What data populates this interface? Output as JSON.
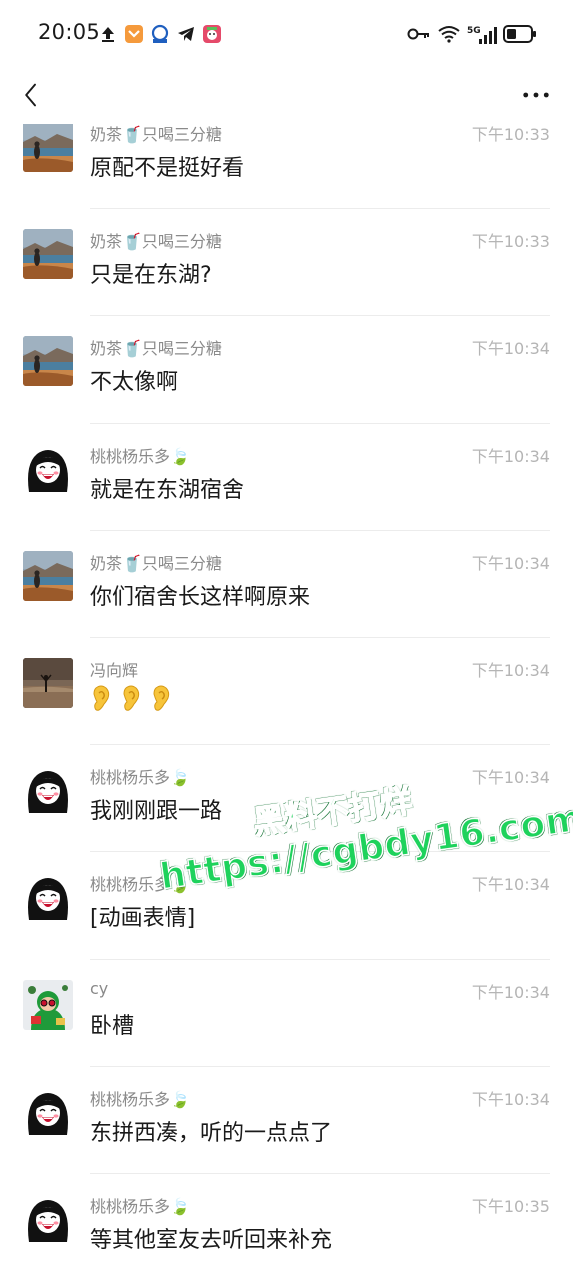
{
  "status_bar": {
    "time": "20:05",
    "network_label": "5G"
  },
  "watermark": {
    "line1": "黑料不打烊",
    "line2": "https://cgbdy16.com"
  },
  "messages": [
    {
      "sender": "奶茶🥤只喝三分糖",
      "time": "下午10:33",
      "text": "原配不是挺好看",
      "avatar": "landscape"
    },
    {
      "sender": "奶茶🥤只喝三分糖",
      "time": "下午10:33",
      "text": "只是在东湖?",
      "avatar": "landscape"
    },
    {
      "sender": "奶茶🥤只喝三分糖",
      "time": "下午10:34",
      "text": "不太像啊",
      "avatar": "landscape"
    },
    {
      "sender": "桃桃杨乐多🍃",
      "time": "下午10:34",
      "text": "就是在东湖宿舍",
      "avatar": "cartoon-girl"
    },
    {
      "sender": "奶茶🥤只喝三分糖",
      "time": "下午10:34",
      "text": "你们宿舍长这样啊原来",
      "avatar": "landscape"
    },
    {
      "sender": "冯向辉",
      "time": "下午10:34",
      "text": "👂👂👂",
      "avatar": "beach"
    },
    {
      "sender": "桃桃杨乐多🍃",
      "time": "下午10:34",
      "text": "我刚刚跟一路",
      "avatar": "cartoon-girl"
    },
    {
      "sender": "桃桃杨乐多🍃",
      "time": "下午10:34",
      "text": "[动画表情]",
      "avatar": "cartoon-girl"
    },
    {
      "sender": "cy",
      "time": "下午10:34",
      "text": "卧槽",
      "avatar": "green-character"
    },
    {
      "sender": "桃桃杨乐多🍃",
      "time": "下午10:34",
      "text": "东拼西凑，听的一点点了",
      "avatar": "cartoon-girl"
    },
    {
      "sender": "桃桃杨乐多🍃",
      "time": "下午10:35",
      "text": "等其他室友去听回来补充",
      "avatar": "cartoon-girl"
    }
  ]
}
